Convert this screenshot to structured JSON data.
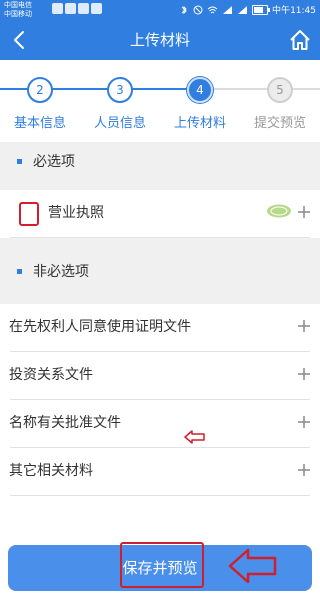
{
  "status_bar": {
    "carrier_1": "中国电信",
    "carrier_2": "中国移动",
    "time_prefix": "中午",
    "time": "11:45"
  },
  "nav": {
    "title": "上传材料"
  },
  "steps": [
    {
      "number": "2",
      "label": "基本信息",
      "state": "done"
    },
    {
      "number": "3",
      "label": "人员信息",
      "state": "done"
    },
    {
      "number": "4",
      "label": "上传材料",
      "state": "active"
    },
    {
      "number": "5",
      "label": "提交预览",
      "state": "todo"
    }
  ],
  "required_section": {
    "title": "必选项",
    "items": [
      {
        "label": "营业执照"
      }
    ]
  },
  "optional_section": {
    "title": "非必选项",
    "items": [
      {
        "label": "在先权利人同意使用证明文件"
      },
      {
        "label": "投资关系文件"
      },
      {
        "label": "名称有关批准文件"
      },
      {
        "label": "其它相关材料"
      }
    ]
  },
  "save_button": {
    "label": "保存并预览"
  },
  "colors": {
    "primary": "#2f7ee0",
    "button": "#4a8fea",
    "annotation_red": "#d11f2b"
  },
  "icons": [
    "back-arrow-icon",
    "home-icon",
    "plus-icon",
    "stamp-icon"
  ]
}
